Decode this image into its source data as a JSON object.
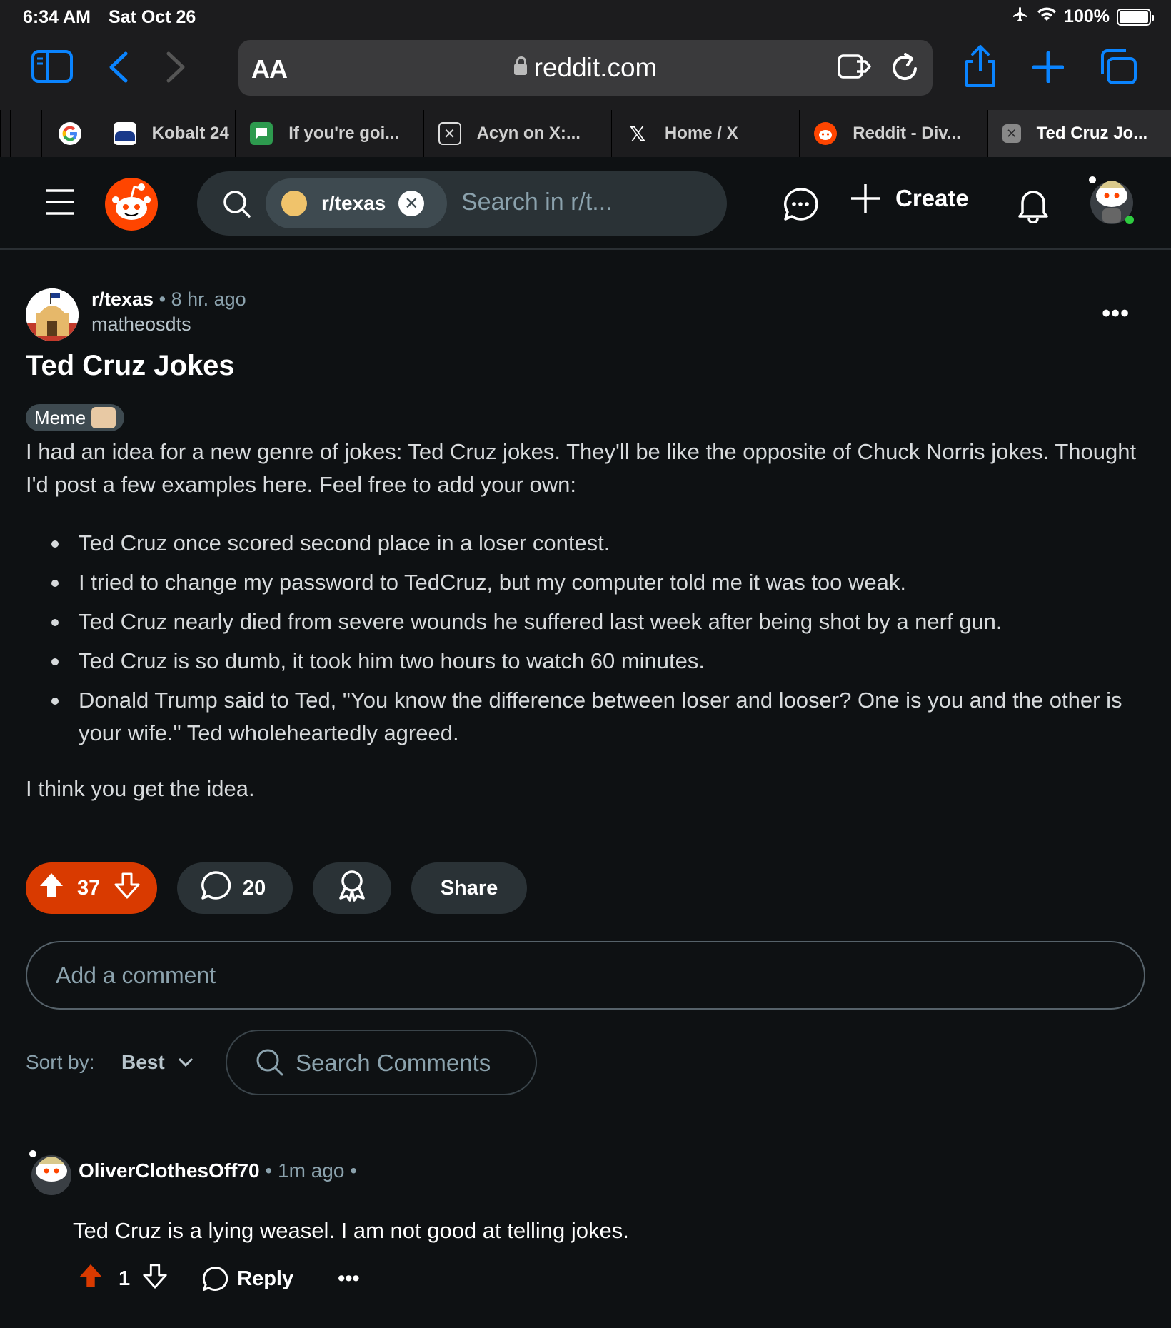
{
  "status_bar": {
    "time": "6:34 AM",
    "date": "Sat Oct 26",
    "battery": "100%"
  },
  "browser": {
    "text_size_label": "AA",
    "url": "reddit.com",
    "tabs": [
      {
        "title": "",
        "icon": "google-icon"
      },
      {
        "title": "Kobalt 24",
        "icon": "kobalt-icon"
      },
      {
        "title": "If you're goi...",
        "icon": "app-icon"
      },
      {
        "title": "Acyn on X:...",
        "icon": "x-close-icon"
      },
      {
        "title": "Home / X",
        "icon": "x-logo-icon"
      },
      {
        "title": "Reddit - Div...",
        "icon": "reddit-icon"
      },
      {
        "title": "Ted Cruz Jo...",
        "icon": "close-tab-icon"
      }
    ]
  },
  "reddit_header": {
    "subreddit_chip": "r/texas",
    "search_placeholder": "Search in r/t...",
    "create_label": "Create"
  },
  "post": {
    "subreddit": "r/texas",
    "time_ago": "8 hr. ago",
    "author": "matheosdts",
    "title": "Ted Cruz Jokes",
    "flair": "Meme",
    "intro": "I had an idea for a new genre of jokes: Ted Cruz jokes. They'll be like the opposite of Chuck Norris jokes. Thought I'd post a few examples here. Feel free to add your own:",
    "bullets": [
      "Ted Cruz once scored second place in a loser contest.",
      "I tried to change my password to TedCruz, but my computer told me it was too weak.",
      "Ted Cruz nearly died from severe wounds he suffered last week after being shot by a nerf gun.",
      "Ted Cruz is so dumb, it took him two hours to watch 60 minutes.",
      "Donald Trump said to Ted, \"You know the difference between loser and looser? One is you and the other is your wife.\" Ted wholeheartedly agreed."
    ],
    "outro": "I think you get the idea.",
    "votes": "37",
    "comments": "20",
    "share_label": "Share"
  },
  "comment_box": {
    "placeholder": "Add a comment"
  },
  "sort": {
    "label": "Sort by:",
    "value": "Best",
    "search_placeholder": "Search Comments"
  },
  "comment": {
    "user": "OliverClothesOff70",
    "time_ago": "1m ago",
    "text": "Ted Cruz is a lying weasel. I am not good at telling jokes.",
    "votes": "1",
    "reply_label": "Reply"
  },
  "colors": {
    "accent_blue": "#0a84ff",
    "upvote_orange": "#d93a00",
    "reddit_orange": "#ff4500",
    "online_green": "#2ecc40"
  }
}
